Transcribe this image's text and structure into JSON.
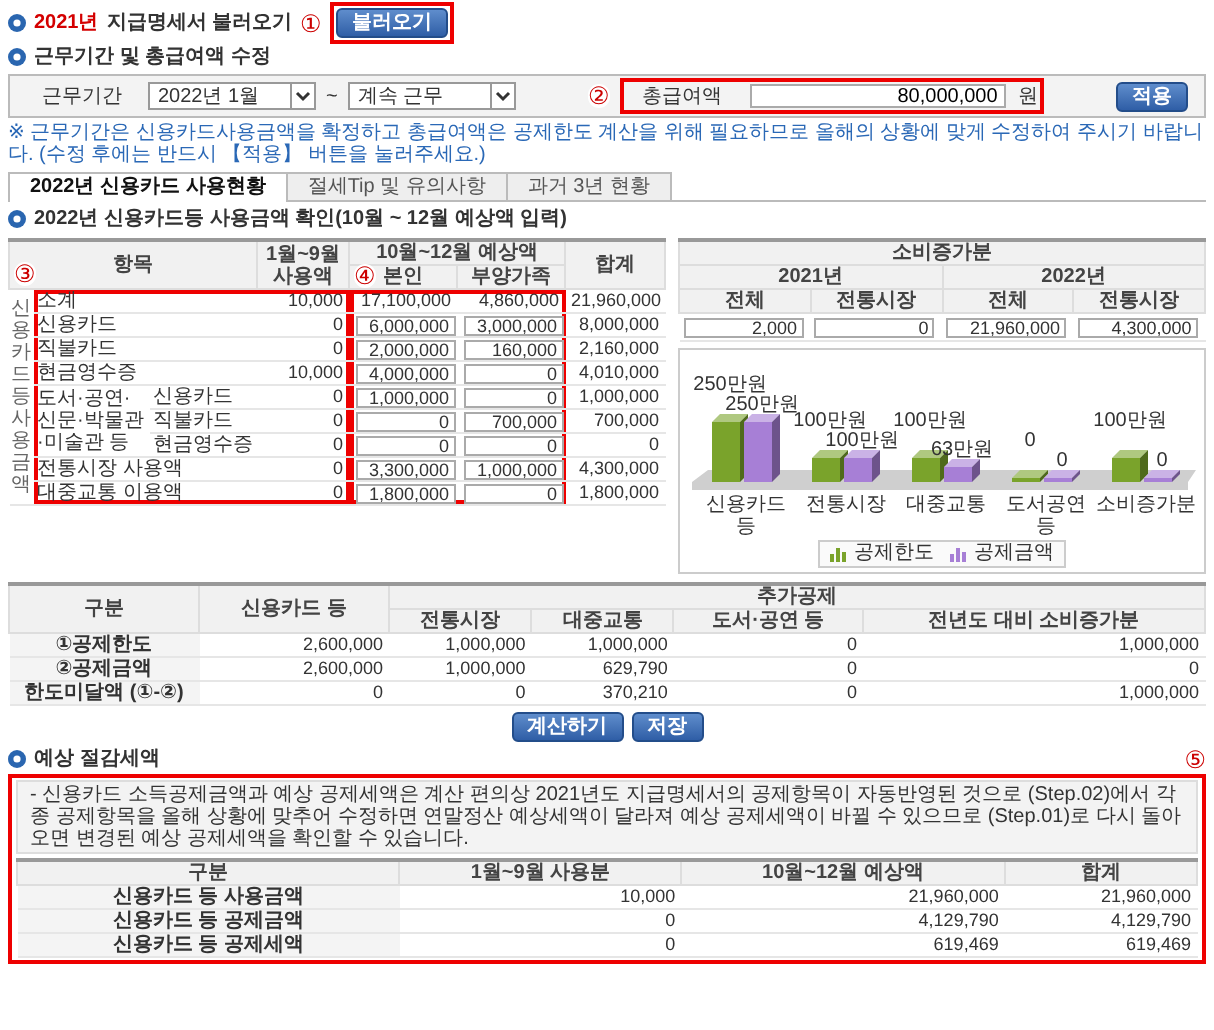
{
  "load_section": {
    "year": "2021년",
    "title": "지급명세서 불러오기",
    "marker": "①",
    "button": "불러오기"
  },
  "period_section": {
    "title": "근무기간 및 총급여액 수정",
    "period_label": "근무기간",
    "start": "2022년 1월",
    "tilde": "~",
    "end": "계속 근무",
    "marker": "②",
    "salary_label": "총급여액",
    "salary": "80,000,000",
    "unit": "원",
    "apply_button": "적용",
    "note": "※ 근무기간은 신용카드사용금액을 확정하고 총급여액은 공제한도 계산을 위해 필요하므로 올해의 상황에 맞게 수정하여 주시기 바랍니다. (수정 후에는 반드시 【적용】 버튼을 눌러주세요.)"
  },
  "tabs": [
    {
      "label": "2022년 신용카드 사용현황",
      "selected": true
    },
    {
      "label": "절세Tip 및 유의사항",
      "selected": false
    },
    {
      "label": "과거 3년 현황",
      "selected": false
    }
  ],
  "usage_section": {
    "title": "2022년 신용카드등 사용금액 확인(10월 ~ 12월 예상액 입력)",
    "columns": {
      "item": "항목",
      "jan_sep": "1월~9월 사용액",
      "oct_dec": "10월~12월 예상액",
      "self": "본인",
      "family": "부양가족",
      "total": "합계"
    },
    "side_label": "신용카드등 사용금액",
    "marker_items": "③",
    "marker_amounts": "④",
    "rows": [
      {
        "kind": "summary",
        "item": "소계",
        "jan_sep": "10,000",
        "self": "17,100,000",
        "family": "4,860,000",
        "total": "21,960,000"
      },
      {
        "kind": "input",
        "item": "신용카드",
        "jan_sep": "0",
        "self": "6,000,000",
        "family": "3,000,000",
        "total": "8,000,000"
      },
      {
        "kind": "input",
        "item": "직불카드",
        "jan_sep": "0",
        "self": "2,000,000",
        "family": "160,000",
        "total": "2,160,000"
      },
      {
        "kind": "input",
        "item": "현금영수증",
        "jan_sep": "10,000",
        "self": "4,000,000",
        "family": "0",
        "total": "4,010,000"
      },
      {
        "kind": "group",
        "item": "도서·공연·신문·박물관·미술관 등",
        "children": [
          {
            "item": "신용카드",
            "jan_sep": "0",
            "self": "1,000,000",
            "family": "0",
            "total": "1,000,000"
          },
          {
            "item": "직불카드",
            "jan_sep": "0",
            "self": "0",
            "family": "700,000",
            "total": "700,000"
          },
          {
            "item": "현금영수증",
            "jan_sep": "0",
            "self": "0",
            "family": "0",
            "total": "0"
          }
        ]
      },
      {
        "kind": "input",
        "item": "전통시장 사용액",
        "jan_sep": "0",
        "self": "3,300,000",
        "family": "1,000,000",
        "total": "4,300,000"
      },
      {
        "kind": "input",
        "item": "대중교통 이용액",
        "jan_sep": "0",
        "self": "1,800,000",
        "family": "0",
        "total": "1,800,000"
      }
    ]
  },
  "increase": {
    "title": "소비증가분",
    "years": [
      "2021년",
      "2022년"
    ],
    "columns": [
      "전체",
      "전통시장",
      "전체",
      "전통시장"
    ],
    "values": [
      "2,000",
      "0",
      "21,960,000",
      "4,300,000"
    ]
  },
  "chart": {
    "chart_data": {
      "type": "bar",
      "legend": "bottom",
      "categories": [
        "신용카드 등",
        "전통시장",
        "대중교통",
        "도서공연 등",
        "소비증가분"
      ],
      "data_labels": true,
      "series": [
        {
          "name": "공제한도",
          "color": "#7aa32b",
          "values": [
            250,
            100,
            100,
            0,
            100
          ],
          "value_labels": [
            "250만원",
            "100만원",
            "100만원",
            "0",
            "100만원"
          ]
        },
        {
          "name": "공제금액",
          "color": "#a77fd6",
          "values": [
            250,
            100,
            63,
            0,
            0
          ],
          "value_labels": [
            "250만원",
            "100만원",
            "63만원",
            "0",
            "0"
          ]
        }
      ]
    }
  },
  "deduction_table": {
    "head": {
      "category": "구분",
      "card": "신용카드 등",
      "extra": "추가공제",
      "extra_columns": [
        "전통시장",
        "대중교통",
        "도서·공연 등",
        "전년도 대비 소비증가분"
      ]
    },
    "rows": [
      {
        "label": "①공제한도",
        "values": [
          "2,600,000",
          "1,000,000",
          "1,000,000",
          "0",
          "1,000,000"
        ]
      },
      {
        "label": "②공제금액",
        "values": [
          "2,600,000",
          "1,000,000",
          "629,790",
          "0",
          "0"
        ]
      },
      {
        "label": "한도미달액 (①-②)",
        "values": [
          "0",
          "0",
          "370,210",
          "0",
          "1,000,000"
        ]
      }
    ]
  },
  "buttons": [
    "계산하기",
    "저장"
  ],
  "savings": {
    "title": "예상 절감세액",
    "marker": "⑤",
    "note": "- 신용카드 소득공제금액과 예상 공제세액은 계산 편의상 2021년도 지급명세서의 공제항목이 자동반영된 것으로 (Step.02)에서 각종 공제항목을 올해 상황에 맞추어 수정하면 연말정산 예상세액이 달라져 예상 공제세액이 바뀔 수 있으므로 (Step.01)로 다시 돌아오면 변경된 예상 공제세액을 확인할 수 있습니다.",
    "columns": [
      "구분",
      "1월~9월 사용분",
      "10월~12월 예상액",
      "합계"
    ],
    "rows": [
      {
        "label": "신용카드 등 사용금액",
        "values": [
          "10,000",
          "21,960,000",
          "21,960,000"
        ]
      },
      {
        "label": "신용카드 등 공제금액",
        "values": [
          "0",
          "4,129,790",
          "4,129,790"
        ]
      },
      {
        "label": "신용카드 등 공제세액",
        "values": [
          "0",
          "619,469",
          "619,469"
        ]
      }
    ]
  }
}
